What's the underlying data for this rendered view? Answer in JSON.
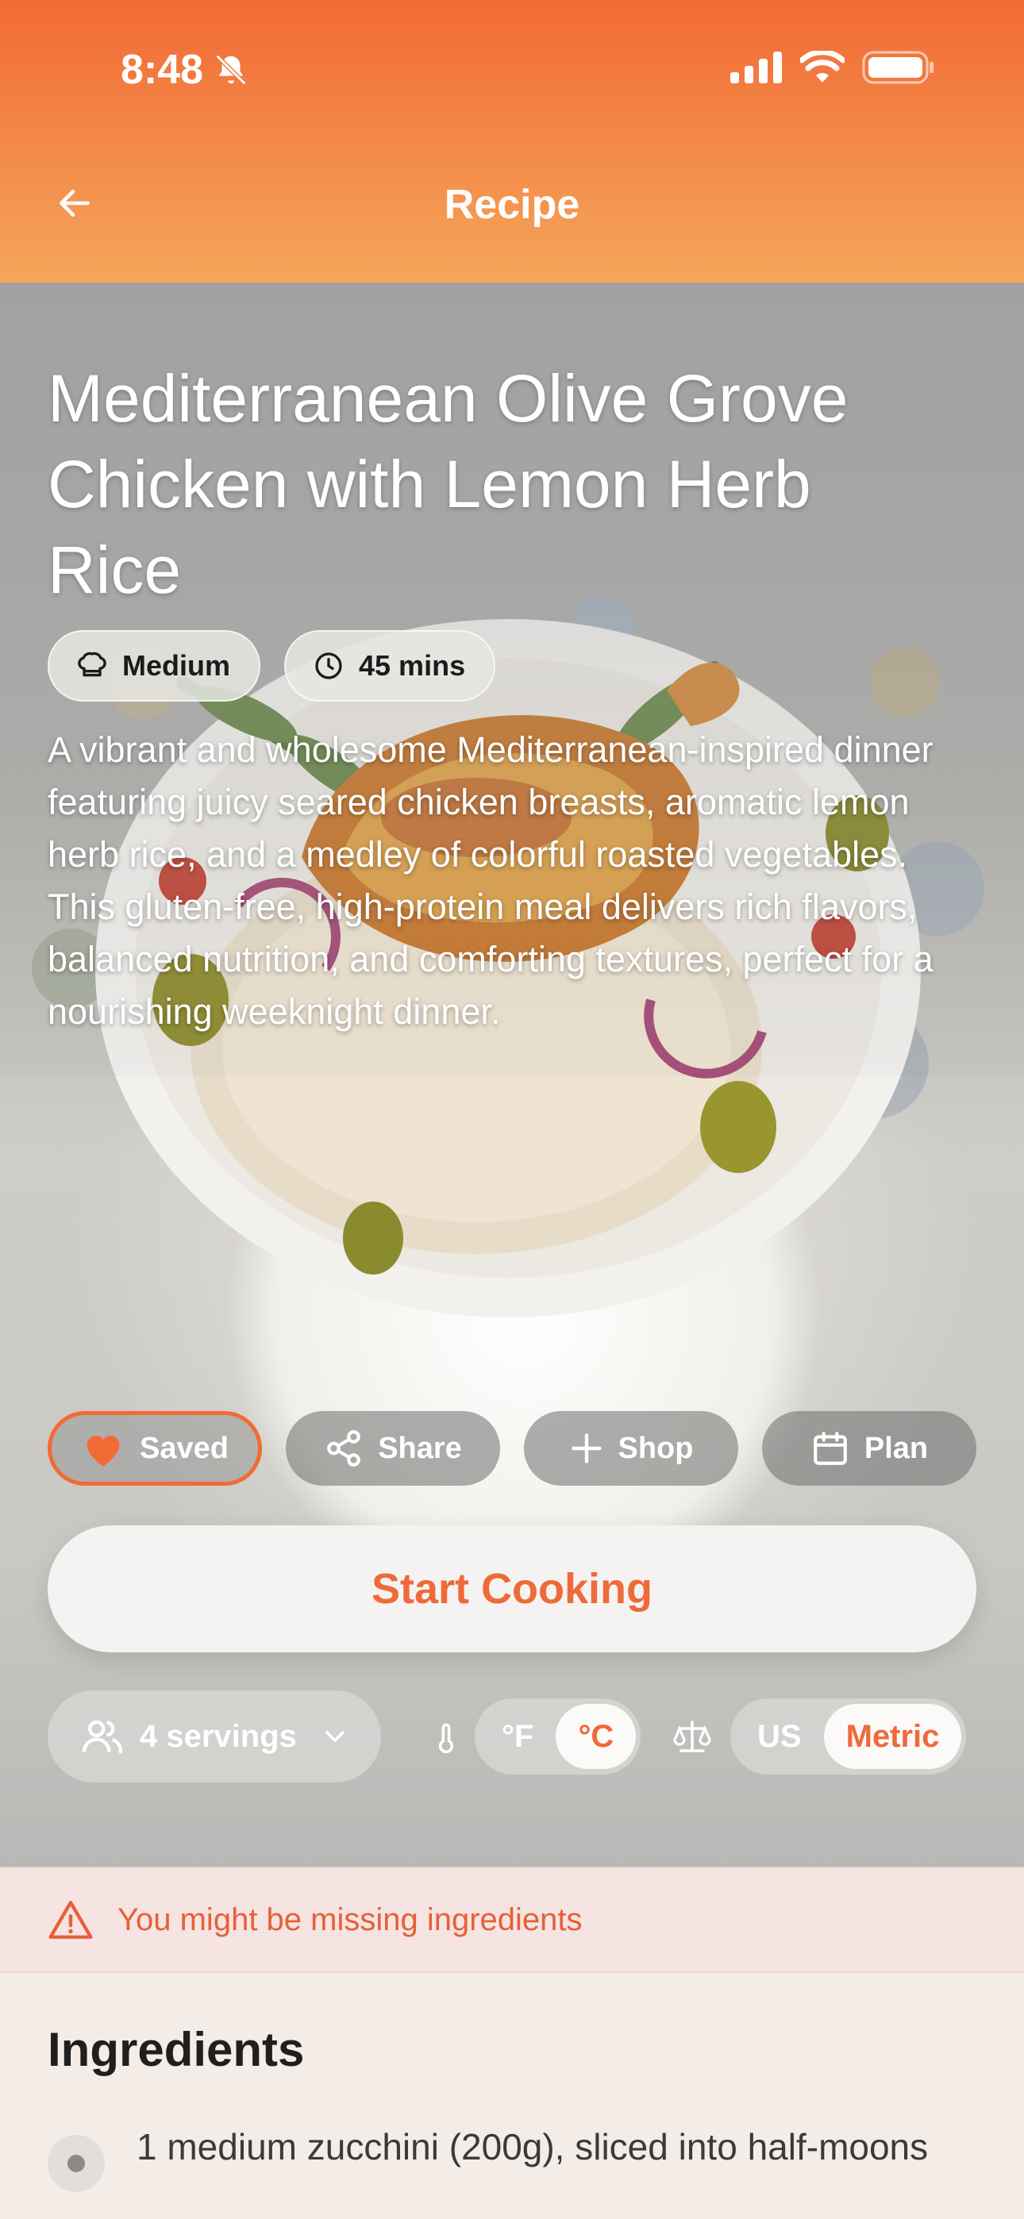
{
  "status": {
    "time": "8:48"
  },
  "nav": {
    "title": "Recipe"
  },
  "recipe": {
    "title": "Mediterranean Olive Grove Chicken with Lemon Herb Rice",
    "difficulty": "Medium",
    "time": "45 mins",
    "description": "A vibrant and wholesome Mediterranean-inspired dinner featuring juicy seared chicken breasts, aromatic lemon herb rice, and a medley of colorful roasted vegetables. This gluten-free, high-protein meal delivers rich flavors, balanced nutrition, and comforting textures, perfect for a nourishing weeknight dinner."
  },
  "actions": {
    "saved": "Saved",
    "share": "Share",
    "shop": "Shop",
    "plan": "Plan"
  },
  "start_cooking": "Start Cooking",
  "controls": {
    "servings": "4 servings",
    "temp_f": "°F",
    "temp_c": "°C",
    "unit_us": "US",
    "unit_metric": "Metric"
  },
  "warning": "You might be missing ingredients",
  "ingredients": {
    "title": "Ingredients",
    "items": [
      "1 medium zucchini (200g), sliced into half-moons"
    ]
  },
  "colors": {
    "accent": "#f26a35",
    "warning_bg": "#f5e4e1"
  }
}
